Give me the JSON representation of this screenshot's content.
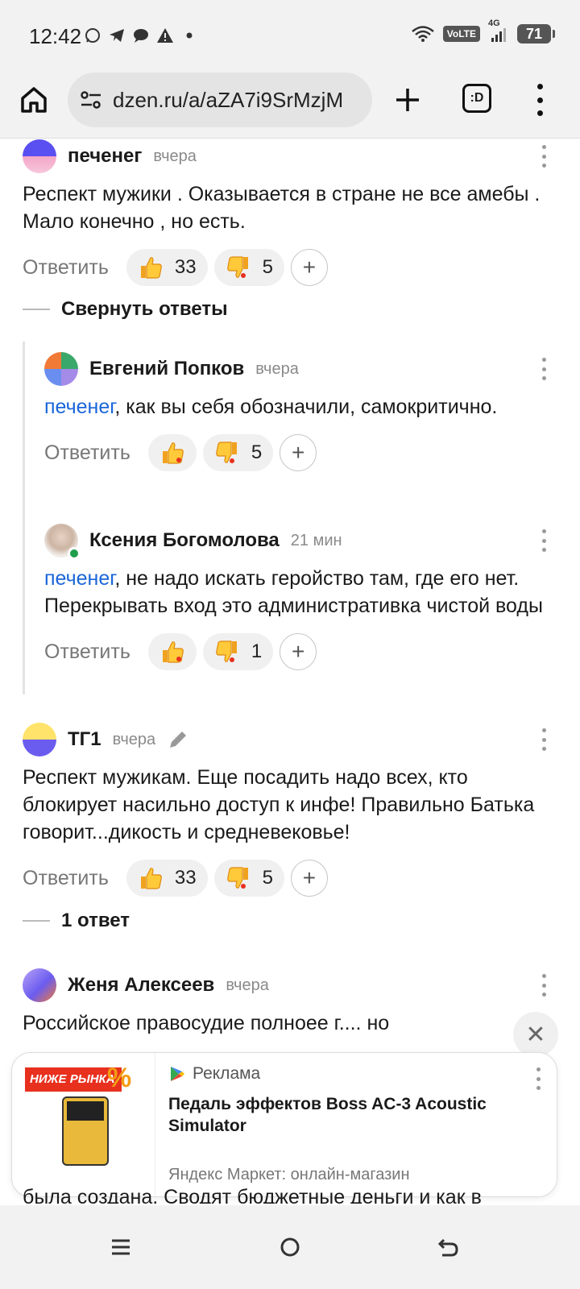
{
  "status": {
    "time": "12:42",
    "volte": "VoLTE",
    "network": "4G",
    "battery": "71"
  },
  "browser": {
    "url": "dzen.ru/a/aZA7i9SrMzjM",
    "tabs_label": ":D"
  },
  "comments": [
    {
      "author": "печенег",
      "time": "вчера",
      "text": "Респект мужики . Оказывается в стране не все амебы . Мало конечно , но есть.",
      "reply": "Ответить",
      "likes": "33",
      "dislikes": "5"
    },
    {
      "author": "Евгений Попков",
      "time": "вчера",
      "mention": "печенег",
      "text": ", как вы себя обозначили, самокритично.",
      "reply": "Ответить",
      "likes": "",
      "dislikes": "5"
    },
    {
      "author": "Ксения Богомолова",
      "time": "21 мин",
      "mention": "печенег",
      "text": ", не надо искать геройство там, где его нет. Перекрывать вход это административка чистой воды",
      "reply": "Ответить",
      "likes": "",
      "dislikes": "1"
    },
    {
      "author": "ТГ1",
      "time": "вчера",
      "text": "Респект мужикам. Еще посадить надо всех, кто блокирует насильно доступ к инфе! Правильно Батька говорит...дикость и средневековье!",
      "reply": "Ответить",
      "likes": "33",
      "dislikes": "5"
    },
    {
      "author": "Женя Алексеев",
      "time": "вчера",
      "text": "Российское правосудие полноее г.... но"
    }
  ],
  "toggles": {
    "collapse": "Свернуть ответы",
    "one_reply": "1 ответ"
  },
  "ad": {
    "label": "Реклама",
    "title": "Педаль эффектов Boss AC-3 Acoustic Simulator",
    "shop": "Яндекс Маркет: онлайн-магазин",
    "badge": "НИЖЕ РЫНКА",
    "badge_pct": "%",
    "close": "✕"
  },
  "peek_text": "была создана. Сводят бюджетные деньги и как в",
  "colors": {
    "mention": "#1a66d9",
    "accent_badge": "#e8301f"
  },
  "icons": {
    "like": "thumbs-up-icon",
    "dislike": "thumbs-down-icon",
    "plus": "add-reaction-icon",
    "edit": "pencil-icon"
  }
}
